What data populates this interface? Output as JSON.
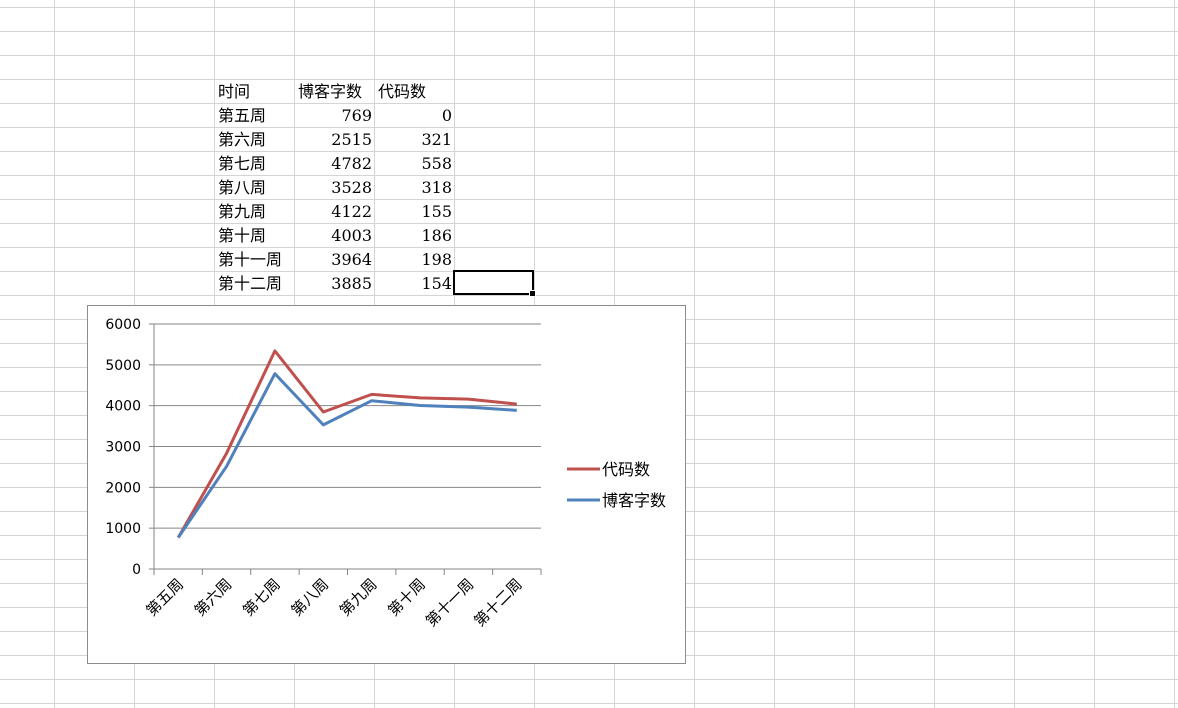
{
  "spreadsheet": {
    "headers": [
      "时间",
      "博客字数",
      "代码数"
    ],
    "rows": [
      [
        "第五周",
        "769",
        "0"
      ],
      [
        "第六周",
        "2515",
        "321"
      ],
      [
        "第七周",
        "4782",
        "558"
      ],
      [
        "第八周",
        "3528",
        "318"
      ],
      [
        "第九周",
        "4122",
        "155"
      ],
      [
        "第十周",
        "4003",
        "186"
      ],
      [
        "第十一周",
        "3964",
        "198"
      ],
      [
        "第十二周",
        "3885",
        "154"
      ]
    ]
  },
  "colors": {
    "series_red": "#c0504d",
    "series_blue": "#4f81bd",
    "gridline": "#868686",
    "cell_grid": "#d4d4d4"
  },
  "chart_data": {
    "type": "line",
    "stacked": true,
    "title": "",
    "xlabel": "",
    "ylabel": "",
    "categories": [
      "第五周",
      "第六周",
      "第七周",
      "第八周",
      "第九周",
      "第十周",
      "第十一周",
      "第十二周"
    ],
    "series": [
      {
        "name": "博客字数",
        "values": [
          769,
          2515,
          4782,
          3528,
          4122,
          4003,
          3964,
          3885
        ],
        "color": "#4f81bd"
      },
      {
        "name": "代码数",
        "values": [
          0,
          321,
          558,
          318,
          155,
          186,
          198,
          154
        ],
        "color": "#c0504d"
      }
    ],
    "legend_order": [
      "代码数",
      "博客字数"
    ],
    "yticks": [
      "0",
      "1000",
      "2000",
      "3000",
      "4000",
      "5000",
      "6000"
    ],
    "ylim": [
      0,
      6000
    ],
    "grid": true,
    "legend_position": "right"
  }
}
